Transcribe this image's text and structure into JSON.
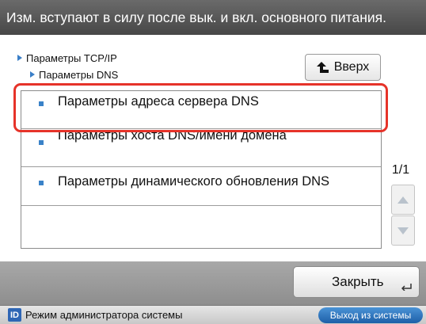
{
  "banner": {
    "text": "Изм. вступают в силу после вык. и вкл. основного питания."
  },
  "breadcrumb": {
    "level1": "Параметры TCP/IP",
    "level2": "Параметры DNS"
  },
  "up_button": {
    "label": "Вверх",
    "icon": "arrow-up-icon"
  },
  "list": {
    "items": [
      {
        "label": "Параметры адреса сервера DNS",
        "selected": true
      },
      {
        "label": "Параметры хоста DNS/имени домена"
      },
      {
        "label": "Параметры динамического обновления DNS"
      }
    ]
  },
  "pager": {
    "page": "1/1"
  },
  "close_button": {
    "label": "Закрыть"
  },
  "status": {
    "mode_text": "Режим администратора системы",
    "id_icon": "ID",
    "logout_label": "Выход из системы"
  },
  "colors": {
    "selection": "#e63329",
    "accent": "#3a82c8",
    "banner": "#555555"
  }
}
